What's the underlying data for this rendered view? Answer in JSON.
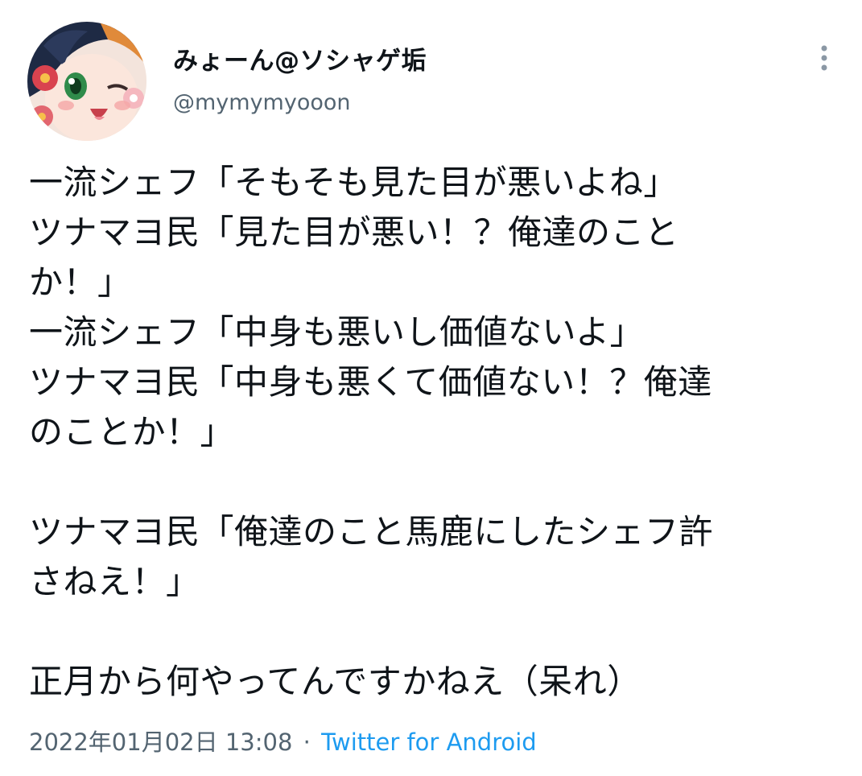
{
  "user": {
    "display_name": "みょーん@ソシャゲ垢",
    "handle": "@mymymyooon"
  },
  "icons": {
    "avatar": "anime-character-avatar",
    "menu": "more-options-vertical-dots-icon"
  },
  "tweet": {
    "lines": [
      "一流シェフ「そもそも見た目が悪いよね」",
      "ツナマヨ民「見た目が悪い！？俺達のこと",
      "か！」",
      "一流シェフ「中身も悪いし価値ないよ」",
      "ツナマヨ民「中身も悪くて価値ない！？俺達",
      "のことか！」",
      "",
      "ツナマヨ民「俺達のこと馬鹿にしたシェフ許",
      "さねえ！」",
      "",
      "正月から何やってんですかねえ（呆れ）"
    ]
  },
  "meta": {
    "timestamp": "2022年01月02日 13:08",
    "separator": "·",
    "source": "Twitter for Android"
  },
  "colors": {
    "text_primary": "#0f1419",
    "text_secondary": "#536471",
    "link": "#1d9bf0"
  }
}
